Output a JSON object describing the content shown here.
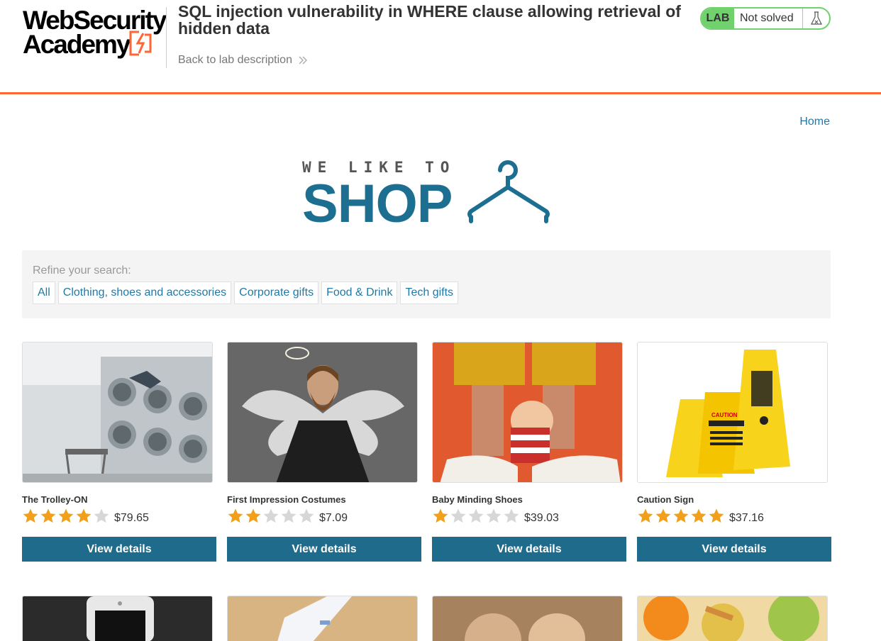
{
  "header": {
    "logo_line1": "WebSecurity",
    "logo_line2": "Academy",
    "lab_title": "SQL injection vulnerability in WHERE clause allowing retrieval of hidden data",
    "back_link": "Back to lab description",
    "lab_tag": "LAB",
    "lab_status": "Not solved"
  },
  "nav": {
    "home": "Home"
  },
  "banner": {
    "tagline": "WE LIKE TO",
    "shop": "SHOP"
  },
  "filter": {
    "label": "Refine your search:",
    "categories": [
      "All",
      "Clothing, shoes and accessories",
      "Corporate gifts",
      "Food & Drink",
      "Tech gifts"
    ]
  },
  "products": [
    {
      "name": "The Trolley-ON",
      "rating": 4,
      "price": "$79.65",
      "button": "View details"
    },
    {
      "name": "First Impression Costumes",
      "rating": 2,
      "price": "$7.09",
      "button": "View details"
    },
    {
      "name": "Baby Minding Shoes",
      "rating": 1,
      "price": "$39.03",
      "button": "View details"
    },
    {
      "name": "Caution Sign",
      "rating": 5,
      "price": "$37.16",
      "button": "View details"
    }
  ],
  "colors": {
    "accent_orange": "#ff6633",
    "lab_green": "#70d16d",
    "link_blue": "#1f7aa6",
    "button_blue": "#1f6b8b",
    "star_filled": "#f0a01a",
    "star_empty": "#d7d7d7"
  },
  "icons": {
    "flask": "flask-icon",
    "chevron": "double-chevron-right-icon",
    "star": "star-icon"
  }
}
